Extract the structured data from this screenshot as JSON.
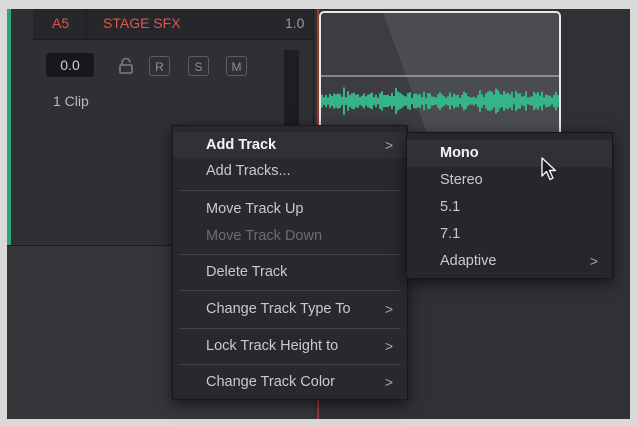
{
  "track": {
    "id": "A5",
    "name": "STAGE SFX",
    "volume": "1.0",
    "volume_field": "0.0",
    "buttons": {
      "record": "R",
      "solo": "S",
      "mute": "M"
    },
    "clip_count": "1 Clip"
  },
  "context_menu": {
    "items": [
      {
        "label": "Add Track",
        "state": "active",
        "submenu": true
      },
      {
        "label": "Add Tracks...",
        "state": "normal",
        "submenu": false
      },
      {
        "label": "Move Track Up",
        "state": "normal",
        "submenu": false
      },
      {
        "label": "Move Track Down",
        "state": "disabled",
        "submenu": false
      },
      {
        "label": "Delete Track",
        "state": "normal",
        "submenu": false
      },
      {
        "label": "Change Track Type To",
        "state": "normal",
        "submenu": true
      },
      {
        "label": "Lock Track Height to",
        "state": "normal",
        "submenu": true
      },
      {
        "label": "Change Track Color",
        "state": "normal",
        "submenu": true
      }
    ],
    "chevron": ">"
  },
  "submenu": {
    "items": [
      {
        "label": "Mono",
        "state": "active"
      },
      {
        "label": "Stereo",
        "state": "normal"
      },
      {
        "label": "5.1",
        "state": "normal"
      },
      {
        "label": "7.1",
        "state": "normal"
      },
      {
        "label": "Adaptive",
        "state": "normal",
        "submenu": true
      }
    ]
  },
  "colors": {
    "track_label": "#e35546",
    "track_accent": "#2fa37a",
    "waveform": "#37b487",
    "playhead": "#9e3a2c"
  },
  "icons": [
    "lock-icon",
    "chevron-right-icon",
    "mouse-pointer-icon"
  ]
}
